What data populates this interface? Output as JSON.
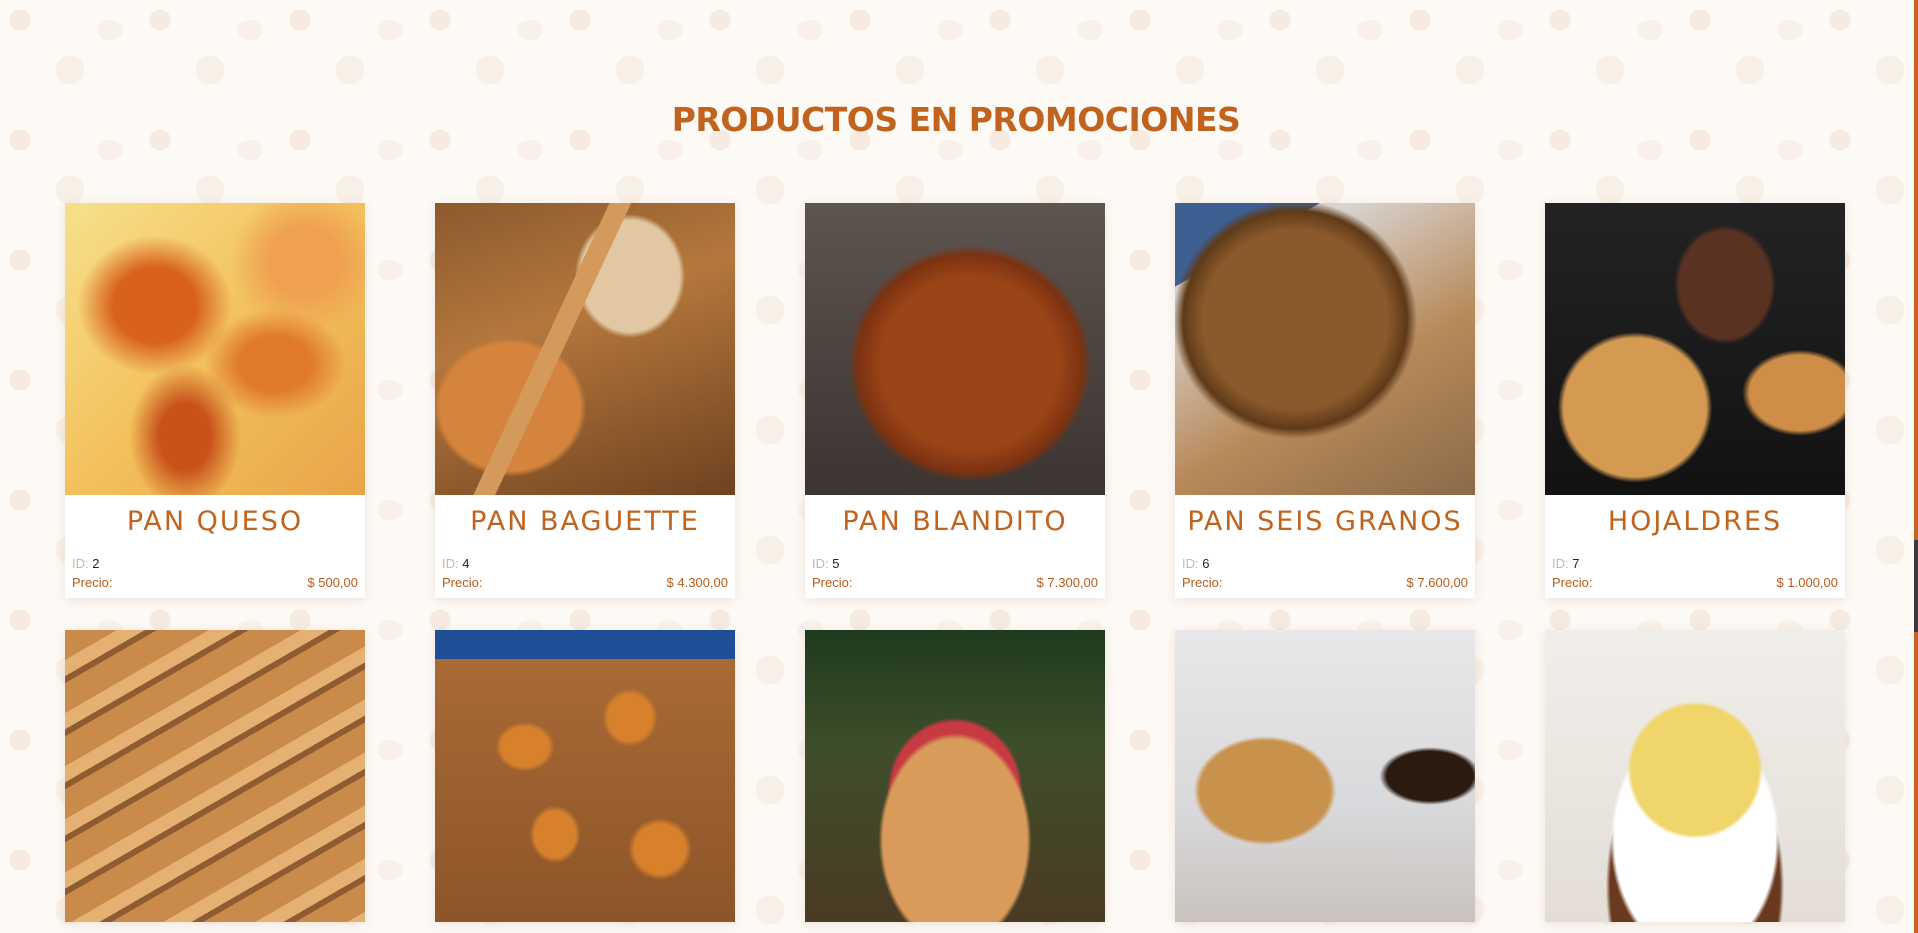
{
  "section": {
    "title": "PRODUCTOS EN PROMOCIONES"
  },
  "labels": {
    "id": "ID:",
    "price": "Precio:"
  },
  "products": [
    {
      "name": "PAN QUESO",
      "id": "2",
      "price": "$ 500,00",
      "image": "cheese-bread-photo"
    },
    {
      "name": "PAN BAGUETTE",
      "id": "4",
      "price": "$ 4.300,00",
      "image": "baguette-photo"
    },
    {
      "name": "PAN BLANDITO",
      "id": "5",
      "price": "$ 7.300,00",
      "image": "sesame-bread-photo"
    },
    {
      "name": "PAN SEIS GRANOS",
      "id": "6",
      "price": "$ 7.600,00",
      "image": "multigrain-bread-photo"
    },
    {
      "name": "HOJALDRES",
      "id": "7",
      "price": "$ 1.000,00",
      "image": "palmier-photo"
    },
    {
      "image": "french-bread-photo"
    },
    {
      "image": "sweet-rolls-photo"
    },
    {
      "image": "bundt-cake-photo"
    },
    {
      "image": "fruit-cake-photo"
    },
    {
      "image": "passionfruit-cake-photo"
    }
  ],
  "colors": {
    "accent": "#c1631d",
    "price": "#b85c17",
    "background": "#fdf9f5"
  }
}
